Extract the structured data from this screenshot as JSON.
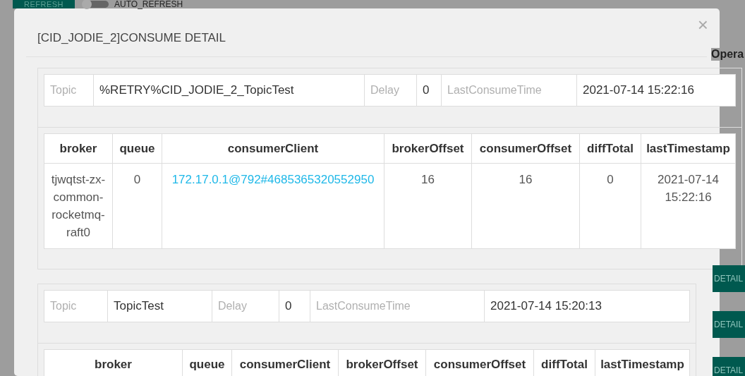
{
  "background": {
    "refresh_button": "REFRESH",
    "auto_refresh": {
      "label": "AUTO_REFRESH",
      "on": false
    },
    "column_header": "Opera",
    "detail_buttons": [
      "DETAIL",
      "DETAIL",
      "DETAIL"
    ]
  },
  "dialog": {
    "title": "[CID_JODIE_2]CONSUME DETAIL",
    "close": "×",
    "groups": [
      {
        "info": [
          {
            "label": "Topic",
            "value": "%RETRY%CID_JODIE_2_TopicTest"
          },
          {
            "label": "Delay",
            "value": "0"
          },
          {
            "label": "LastConsumeTime",
            "value": "2021-07-14 15:22:16"
          }
        ],
        "table": {
          "columns": [
            "broker",
            "queue",
            "consumerClient",
            "brokerOffset",
            "consumerOffset",
            "diffTotal",
            "lastTimestamp"
          ],
          "rows": [
            [
              "tjwqtst-zx-common-rocketmq-raft0",
              "0",
              "172.17.0.1@792#4685365320552950",
              "16",
              "16",
              "0",
              "2021-07-14 15:22:16"
            ]
          ]
        }
      },
      {
        "info": [
          {
            "label": "Topic",
            "value": "TopicTest"
          },
          {
            "label": "Delay",
            "value": "0"
          },
          {
            "label": "LastConsumeTime",
            "value": "2021-07-14 15:20:13"
          }
        ],
        "table": {
          "columns": [
            "broker",
            "queue",
            "consumerClient",
            "brokerOffset",
            "consumerOffset",
            "diffTotal",
            "lastTimestamp"
          ]
        }
      }
    ]
  }
}
